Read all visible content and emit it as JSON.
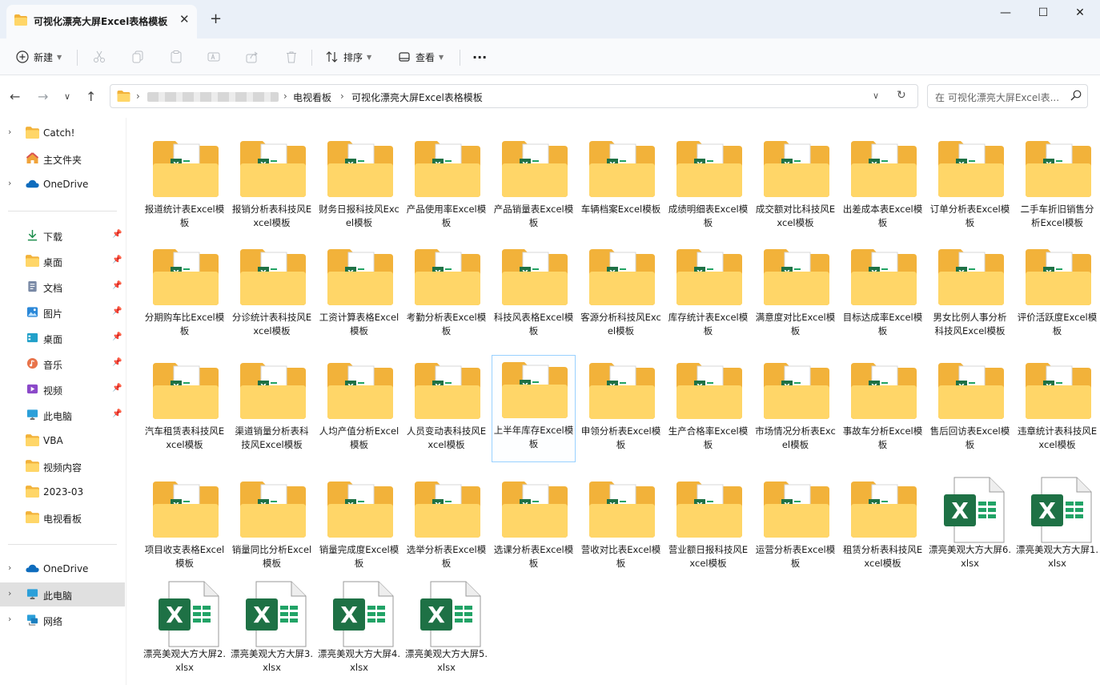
{
  "window": {
    "tab_title": "可视化漂亮大屏Excel表格模板",
    "tab_close": "✕",
    "new_tab": "+",
    "minimize": "—",
    "maximize": "☐",
    "close": "✕"
  },
  "toolbar": {
    "new_label": "新建",
    "sort_label": "排序",
    "view_label": "查看",
    "more_label": "···"
  },
  "address": {
    "crumbs": [
      "电视看板",
      "可视化漂亮大屏Excel表格模板"
    ],
    "search_placeholder": "在 可视化漂亮大屏Excel表..."
  },
  "sidebar": {
    "items": [
      {
        "label": "Catch!",
        "icon": "folder-icon",
        "expandable": true,
        "pinned": false
      },
      {
        "label": "主文件夹",
        "icon": "home-icon",
        "expandable": false,
        "pinned": false
      },
      {
        "label": "OneDrive",
        "icon": "cloud-icon",
        "expandable": true,
        "pinned": false
      },
      {
        "label": "下载",
        "icon": "download-icon",
        "expandable": false,
        "pinned": true
      },
      {
        "label": "桌面",
        "icon": "folder-icon",
        "expandable": false,
        "pinned": true
      },
      {
        "label": "文档",
        "icon": "document-icon",
        "expandable": false,
        "pinned": true
      },
      {
        "label": "图片",
        "icon": "picture-icon",
        "expandable": false,
        "pinned": true
      },
      {
        "label": "桌面",
        "icon": "desktop-icon",
        "expandable": false,
        "pinned": true
      },
      {
        "label": "音乐",
        "icon": "music-icon",
        "expandable": false,
        "pinned": true
      },
      {
        "label": "视频",
        "icon": "video-icon",
        "expandable": false,
        "pinned": true
      },
      {
        "label": "此电脑",
        "icon": "computer-icon",
        "expandable": false,
        "pinned": true
      },
      {
        "label": "VBA",
        "icon": "folder-icon",
        "expandable": false,
        "pinned": false
      },
      {
        "label": "视频内容",
        "icon": "folder-icon",
        "expandable": false,
        "pinned": false
      },
      {
        "label": "2023-03",
        "icon": "folder-icon",
        "expandable": false,
        "pinned": false
      },
      {
        "label": "电视看板",
        "icon": "folder-icon",
        "expandable": false,
        "pinned": false
      },
      {
        "label": "OneDrive",
        "icon": "cloud-icon",
        "expandable": true,
        "pinned": false
      },
      {
        "label": "此电脑",
        "icon": "computer-icon",
        "expandable": true,
        "pinned": false,
        "active": true
      },
      {
        "label": "网络",
        "icon": "network-icon",
        "expandable": true,
        "pinned": false
      }
    ]
  },
  "files": [
    {
      "name": "报道统计表Excel模板",
      "type": "folder"
    },
    {
      "name": "报销分析表科技风Excel模板",
      "type": "folder"
    },
    {
      "name": "财务日报科技风Excel模板",
      "type": "folder"
    },
    {
      "name": "产品使用率Excel模板",
      "type": "folder"
    },
    {
      "name": "产品销量表Excel模板",
      "type": "folder"
    },
    {
      "name": "车辆档案Excel模板",
      "type": "folder"
    },
    {
      "name": "成绩明细表Excel模板",
      "type": "folder"
    },
    {
      "name": "成交额对比科技风Excel模板",
      "type": "folder"
    },
    {
      "name": "出差成本表Excel模板",
      "type": "folder"
    },
    {
      "name": "订单分析表Excel模板",
      "type": "folder"
    },
    {
      "name": "二手车折旧销售分析Excel模板",
      "type": "folder"
    },
    {
      "name": "分期购车比Excel模板",
      "type": "folder"
    },
    {
      "name": "分诊统计表科技风Excel模板",
      "type": "folder"
    },
    {
      "name": "工资计算表格Excel模板",
      "type": "folder"
    },
    {
      "name": "考勤分析表Excel模板",
      "type": "folder"
    },
    {
      "name": "科技风表格Excel模板",
      "type": "folder"
    },
    {
      "name": "客源分析科技风Excel模板",
      "type": "folder"
    },
    {
      "name": "库存统计表Excel模板",
      "type": "folder"
    },
    {
      "name": "满意度对比Excel模板",
      "type": "folder"
    },
    {
      "name": "目标达成率Excel模板",
      "type": "folder"
    },
    {
      "name": "男女比例人事分析科技风Excel模板",
      "type": "folder"
    },
    {
      "name": "评价活跃度Excel模板",
      "type": "folder"
    },
    {
      "name": "汽车租赁表科技风Excel模板",
      "type": "folder"
    },
    {
      "name": "渠道销量分析表科技风Excel模板",
      "type": "folder"
    },
    {
      "name": "人均产值分析Excel模板",
      "type": "folder"
    },
    {
      "name": "人员变动表科技风Excel模板",
      "type": "folder"
    },
    {
      "name": "上半年库存Excel模板",
      "type": "folder",
      "selected": true
    },
    {
      "name": "申领分析表Excel模板",
      "type": "folder"
    },
    {
      "name": "生产合格率Excel模板",
      "type": "folder"
    },
    {
      "name": "市场情况分析表Excel模板",
      "type": "folder"
    },
    {
      "name": "事故车分析Excel模板",
      "type": "folder"
    },
    {
      "name": "售后回访表Excel模板",
      "type": "folder"
    },
    {
      "name": "违章统计表科技风Excel模板",
      "type": "folder"
    },
    {
      "name": "项目收支表格Excel模板",
      "type": "folder"
    },
    {
      "name": "销量同比分析Excel模板",
      "type": "folder"
    },
    {
      "name": "销量完成度Excel模板",
      "type": "folder"
    },
    {
      "name": "选举分析表Excel模板",
      "type": "folder"
    },
    {
      "name": "选课分析表Excel模板",
      "type": "folder"
    },
    {
      "name": "营收对比表Excel模板",
      "type": "folder"
    },
    {
      "name": "营业额日报科技风Excel模板",
      "type": "folder"
    },
    {
      "name": "运营分析表Excel模板",
      "type": "folder"
    },
    {
      "name": "租赁分析表科技风Excel模板",
      "type": "folder"
    },
    {
      "name": "漂亮美观大方大屏6.xlsx",
      "type": "xlsx"
    },
    {
      "name": "漂亮美观大方大屏1.xlsx",
      "type": "xlsx"
    },
    {
      "name": "漂亮美观大方大屏2.xlsx",
      "type": "xlsx"
    },
    {
      "name": "漂亮美观大方大屏3.xlsx",
      "type": "xlsx"
    },
    {
      "name": "漂亮美观大方大屏4.xlsx",
      "type": "xlsx"
    },
    {
      "name": "漂亮美观大方大屏5.xlsx",
      "type": "xlsx"
    }
  ],
  "colors": {
    "folder_back": "#f2b23a",
    "folder_front": "#ffd668",
    "excel_green": "#1e7145",
    "selection_border": "#99d1ff"
  }
}
